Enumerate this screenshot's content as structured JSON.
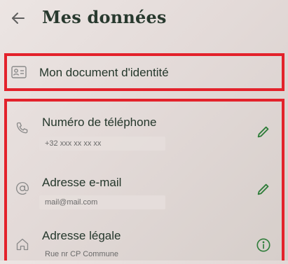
{
  "header": {
    "title": "Mes données"
  },
  "identity_document": {
    "label": "Mon document d'identité"
  },
  "rows": [
    {
      "label": "Numéro de téléphone",
      "value": "+32 xxx xx xx xx",
      "action": "edit"
    },
    {
      "label": "Adresse e-mail",
      "value": "mail@mail.com",
      "action": "edit"
    },
    {
      "label": "Adresse légale",
      "value": "Rue nr CP Commune",
      "action": "info"
    }
  ],
  "icons": {
    "back": "back-arrow-icon",
    "identity": "id-card-icon",
    "phone": "phone-icon",
    "email": "at-sign-icon",
    "address": "home-icon",
    "edit": "pencil-icon",
    "info": "info-icon"
  },
  "colors": {
    "highlight": "#e3222b",
    "edit_icon": "#2f7d3a",
    "title": "#28392e"
  }
}
